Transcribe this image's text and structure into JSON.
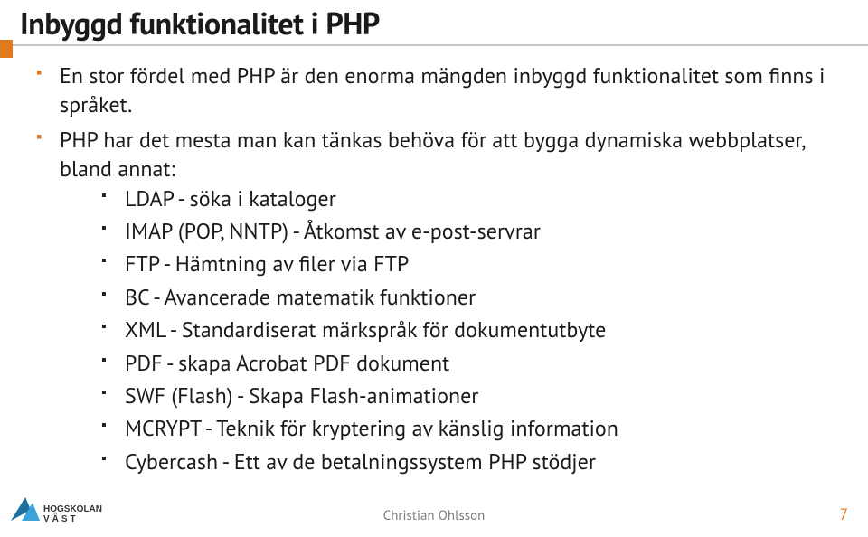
{
  "title": "Inbyggd funktionalitet i PHP",
  "bullets": [
    {
      "text": "En stor fördel med PHP är den enorma mängden inbyggd funktionalitet som finns i språket.",
      "children": []
    },
    {
      "text": "PHP har det mesta man kan tänkas behöva för att bygga dynamiska webbplatser, bland annat:",
      "children": [
        "LDAP - söka i kataloger",
        "IMAP (POP, NNTP) - Åtkomst av e-post-servrar",
        "FTP - Hämtning av filer via FTP",
        "BC - Avancerade matematik funktioner",
        "XML - Standardiserat märkspråk för dokumentutbyte",
        "PDF - skapa Acrobat PDF dokument",
        "SWF (Flash) - Skapa Flash-animationer",
        "MCRYPT - Teknik för kryptering av känslig information",
        "Cybercash - Ett av de betalningssystem PHP stödjer"
      ]
    }
  ],
  "footer": {
    "author": "Christian Ohlsson",
    "page": "7",
    "logo_main": "HÖGSKOLAN",
    "logo_sub": "VÄST"
  },
  "colors": {
    "accent": "#e07a1f"
  }
}
